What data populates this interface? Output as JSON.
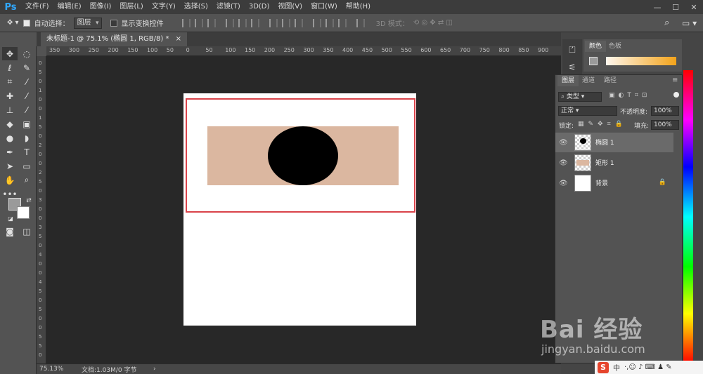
{
  "app": {
    "logo": "Ps"
  },
  "menu": [
    "文件(F)",
    "编辑(E)",
    "图像(I)",
    "图层(L)",
    "文字(Y)",
    "选择(S)",
    "滤镜(T)",
    "3D(D)",
    "视图(V)",
    "窗口(W)",
    "帮助(H)"
  ],
  "window_controls": {
    "minimize": "—",
    "maximize": "☐",
    "close": "✕"
  },
  "options": {
    "auto_select_label": "自动选择：",
    "auto_select_value": "图层",
    "show_transform_label": "显示变换控件",
    "mode_3d_label": "3D 模式："
  },
  "document": {
    "tab_title": "未标题-1 @ 75.1% (椭圆 1, RGB/8) *",
    "close": "×"
  },
  "ruler_top": [
    "350",
    "300",
    "250",
    "200",
    "150",
    "100",
    "50",
    "0",
    "50",
    "100",
    "150",
    "200",
    "250",
    "300",
    "350",
    "400",
    "450",
    "500",
    "550",
    "600",
    "650",
    "700",
    "750",
    "800",
    "850",
    "900"
  ],
  "ruler_left": [
    "0",
    "5",
    "0",
    "1",
    "0",
    "0",
    "1",
    "5",
    "0",
    "2",
    "0",
    "0",
    "2",
    "5",
    "0",
    "3",
    "0",
    "0",
    "3",
    "5",
    "0",
    "4",
    "0",
    "0",
    "4",
    "5",
    "0",
    "5",
    "0",
    "0",
    "5",
    "5",
    "0"
  ],
  "status": {
    "zoom": "75.13%",
    "doc_info": "文档:1.03M/0 字节",
    "arrow": "›"
  },
  "color_panel": {
    "tabs": [
      "颜色",
      "色板"
    ]
  },
  "layers_panel": {
    "tabs": [
      "图层",
      "通道",
      "路径"
    ],
    "filter_kind": "类型",
    "blend_mode": "正常",
    "opacity_label": "不透明度:",
    "opacity_value": "100%",
    "lock_label": "锁定:",
    "fill_label": "填充:",
    "fill_value": "100%",
    "layers": [
      {
        "name": "椭圆 1",
        "selected": true
      },
      {
        "name": "矩形 1",
        "selected": false
      },
      {
        "name": "背景",
        "selected": false
      }
    ]
  },
  "watermark": {
    "brand": "Bai 经验",
    "url": "jingyan.baidu.com"
  },
  "ime": {
    "logo": "S",
    "label": "中"
  },
  "colors": {
    "canvas_bg": "#282828",
    "rect_fill": "#dbb7a0",
    "ellipse_fill": "#000000",
    "highlight_frame": "#d9434a"
  }
}
